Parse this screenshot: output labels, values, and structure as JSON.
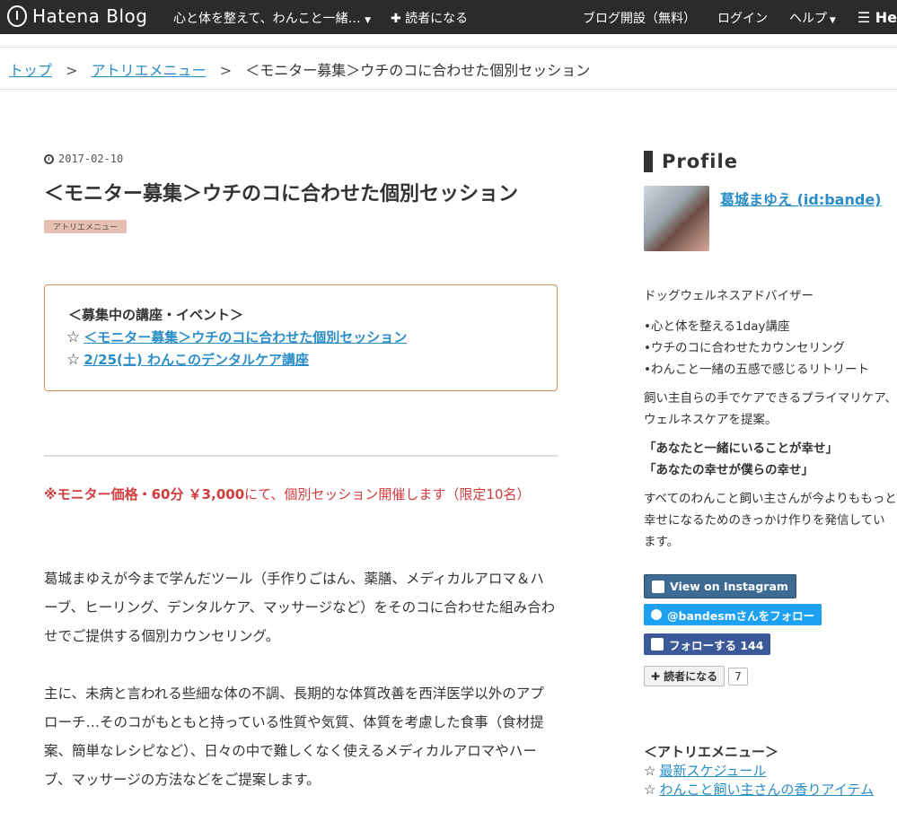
{
  "topbar": {
    "logo_text": "Hatena Blog",
    "blog_name": "心と体を整えて、わんこと一緒…",
    "subscribe_label": "✚ 読者になる",
    "open_blog_label": "ブログ開設（無料）",
    "login_label": "ログイン",
    "help_label": "ヘルプ",
    "extra_label": "He"
  },
  "breadcrumb": {
    "top": "トップ",
    "category": "アトリエメニュー",
    "current": "＜モニター募集＞ウチのコに合わせた個別セッション",
    "separator": ">"
  },
  "article": {
    "date": "2017-02-10",
    "title": "＜モニター募集＞ウチのコに合わせた個別セッション",
    "category_tag": "アトリエメニュー",
    "event_box": {
      "heading": "＜募集中の講座・イベント＞",
      "items": [
        "＜モニター募集＞ウチのコに合わせた個別セッション",
        "2/25(土) わんこのデンタルケア講座"
      ]
    },
    "price_bold": "※モニター価格・60分 ￥3,000",
    "price_rest": "にて、個別セッション開催します（限定10名）",
    "paragraphs": [
      "葛城まゆえが今まで学んだツール（手作りごはん、薬膳、メディカルアロマ＆ハーブ、ヒーリング、デンタルケア、マッサージなど）をそのコに合わせた組み合わせでご提供する個別カウンセリング。",
      "主に、未病と言われる些細な体の不調、長期的な体質改善を西洋医学以外のアプローチ…そのコがもともと持っている性質や気質、体質を考慮した食事（食材提案、簡単なレシピなど）、日々の中で難しくなく使えるメディカルアロマやハーブ、マッサージの方法などをご提案します。"
    ]
  },
  "sidebar": {
    "profile_title": "Profile",
    "profile_name": "葛城まゆえ (id:bande)",
    "role": "ドッグウェルネスアドバイザー",
    "services": [
      "•心と体を整える1day講座",
      "•ウチのコに合わせたカウンセリング",
      "•わんこと一緒の五感で感じるリトリート"
    ],
    "intro": "飼い主自らの手でケアできるプライマリケア、ウェルネスケアを提案。",
    "quote1": "「あなたと一緒にいることが幸せ」",
    "quote2": "「あなたの幸せが僕らの幸せ」",
    "mission": "すべてのわんこと飼い主さんが今よりももっと幸せになるためのきっかけ作りを発信しています。",
    "instagram_label": "View on Instagram",
    "twitter_label": "@bandesmさんをフォロー",
    "facebook_label": "フォローする 144",
    "reader_label": "読者になる",
    "reader_count": "7",
    "menu_heading": "＜アトリエメニュー＞",
    "menu_items": [
      "最新スケジュール",
      "わんこと飼い主さんの香りアイテム"
    ]
  },
  "colors": {
    "link": "#2a8dc8",
    "accent_red": "#d13c3c",
    "box_border": "#d68f57",
    "topbar_bg": "#2b2b2b"
  }
}
